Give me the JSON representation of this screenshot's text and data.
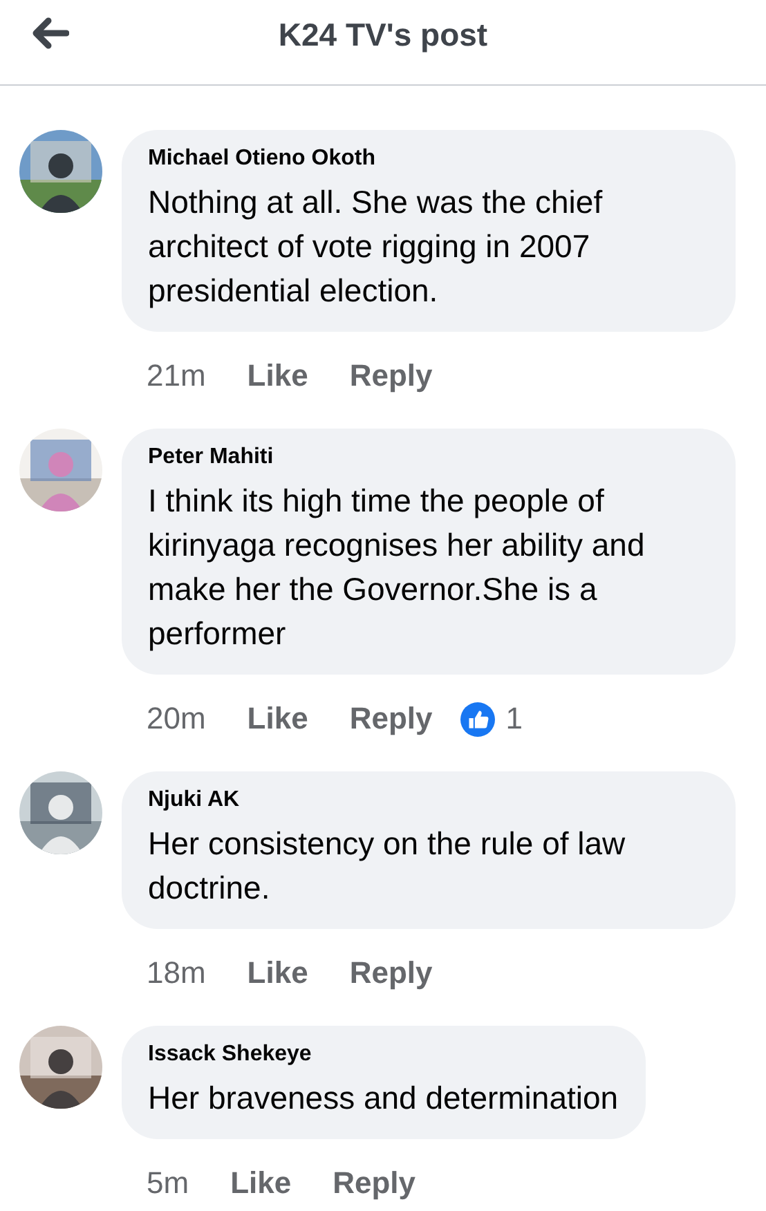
{
  "header": {
    "title": "K24 TV's post"
  },
  "comments": [
    {
      "author": "Michael Otieno Okoth",
      "text": "Nothing at all. She was the chief architect of vote rigging in 2007 presidential election.",
      "time": "21m",
      "like": "Like",
      "reply": "Reply"
    },
    {
      "author": "Peter Mahiti",
      "text": "I think its high time the people of kirinyaga recognises her ability and make her the Governor.She is a performer",
      "time": "20m",
      "like": "Like",
      "reply": "Reply",
      "reactions": "1"
    },
    {
      "author": "Njuki AK",
      "text": "Her consistency on the rule of law doctrine.",
      "time": "18m",
      "like": "Like",
      "reply": "Reply"
    },
    {
      "author": "Issack Shekeye",
      "text": "Her braveness and determination",
      "time": "5m",
      "like": "Like",
      "reply": "Reply"
    }
  ]
}
